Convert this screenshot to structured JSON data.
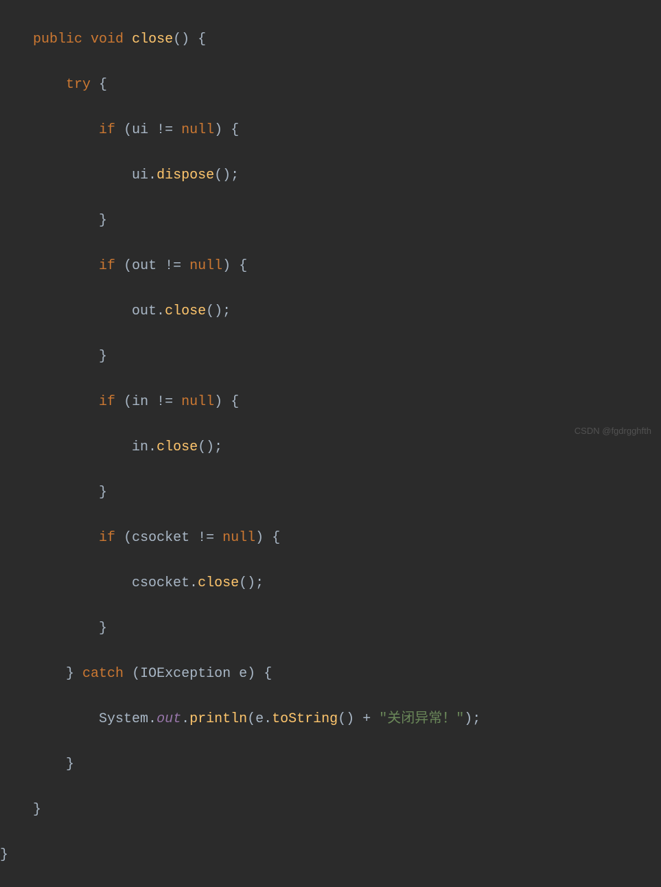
{
  "code": {
    "t0": "    ",
    "t1": "        ",
    "t2": "            ",
    "t3": "                ",
    "kw_public": "public",
    "kw_void": "void",
    "kw_try": "try",
    "kw_catch": "catch",
    "kw_if": "if",
    "kw_null": "null",
    "method_close": "close",
    "method_dispose": "dispose",
    "method_println": "println",
    "method_toString": "toString",
    "var_ui": "ui",
    "var_out": "out",
    "var_in": "in",
    "var_csocket": "csocket",
    "var_e": "e",
    "cls_system": "System",
    "field_out": "out",
    "cls_ioexception": "IOException",
    "str_close_err": "\"关闭异常！\"",
    "op_ne": "!=",
    "op_plus": "+",
    "dot": ".",
    "semi": ";",
    "lparen": "(",
    "rparen": ")",
    "lbrace": "{",
    "rbrace": "}",
    "space": " "
  },
  "watermark": "CSDN @fgdrgghfth"
}
